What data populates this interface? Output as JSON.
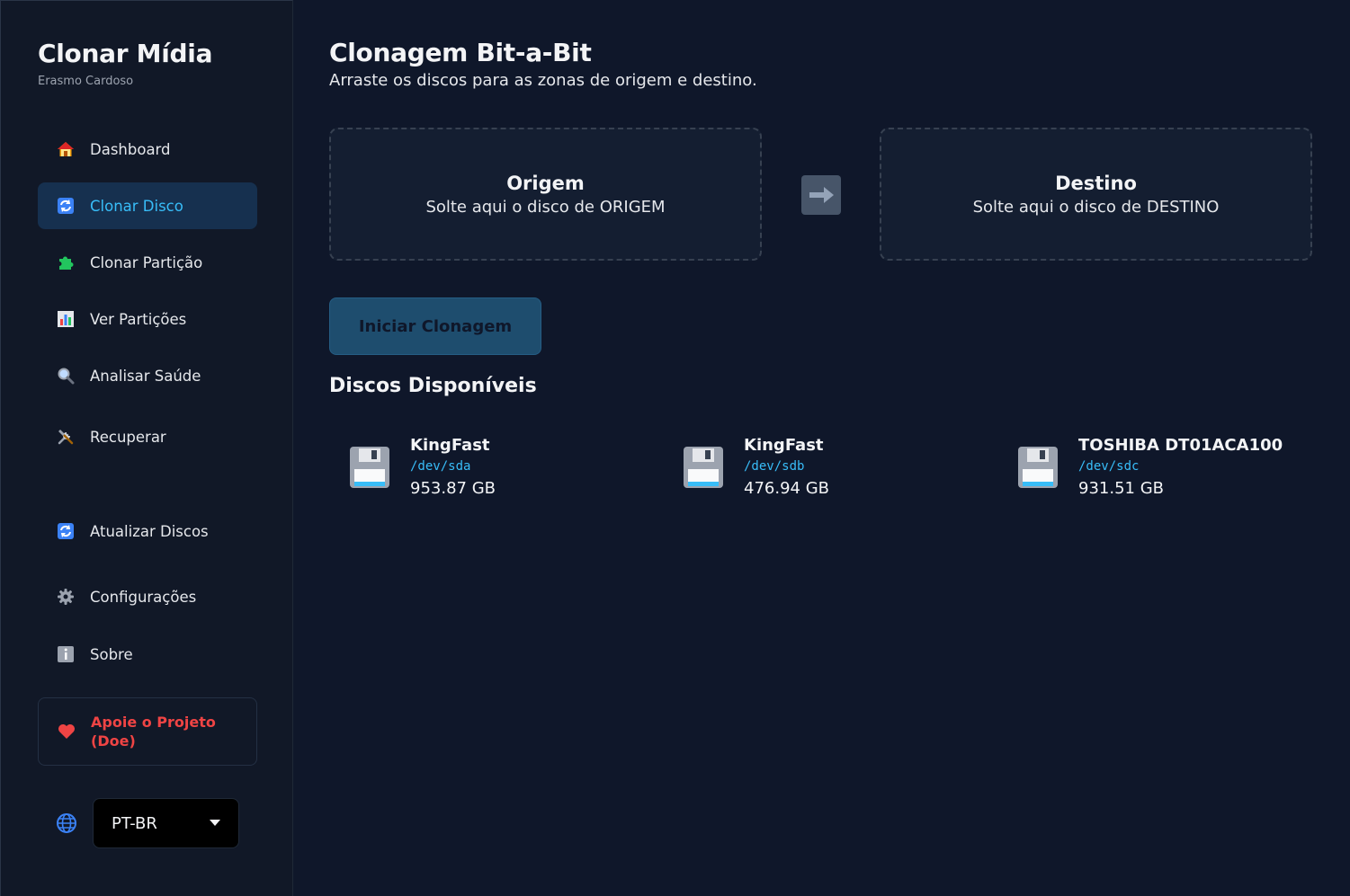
{
  "sidebar": {
    "brand_title": "Clonar Mídia",
    "brand_subtitle": "Erasmo Cardoso",
    "items": [
      {
        "label": "Dashboard",
        "icon": "house-icon"
      },
      {
        "label": "Clonar Disco",
        "icon": "refresh-icon",
        "active": true
      },
      {
        "label": "Clonar Partição",
        "icon": "puzzle-icon"
      },
      {
        "label": "Ver Partições",
        "icon": "bar-chart-icon"
      },
      {
        "label": "Analisar Saúde",
        "icon": "magnifier-icon"
      },
      {
        "label": "Recuperar",
        "icon": "tools-icon"
      }
    ],
    "bottom_items": [
      {
        "label": "Atualizar Discos",
        "icon": "refresh-icon"
      },
      {
        "label": "Configurações",
        "icon": "gear-icon"
      },
      {
        "label": "Sobre",
        "icon": "info-icon"
      }
    ],
    "donate_label": "Apoie o Projeto (Doe)",
    "language": "PT-BR"
  },
  "main": {
    "title": "Clonagem Bit-a-Bit",
    "subtitle": "Arraste os discos para as zonas de origem e destino.",
    "source": {
      "title": "Origem",
      "hint": "Solte aqui o disco de ORIGEM"
    },
    "target": {
      "title": "Destino",
      "hint": "Solte aqui o disco de DESTINO"
    },
    "start_button": "Iniciar Clonagem",
    "disks_title": "Discos Disponíveis",
    "disks": [
      {
        "name": "KingFast",
        "path": "/dev/sda",
        "size": "953.87 GB"
      },
      {
        "name": "KingFast",
        "path": "/dev/sdb",
        "size": "476.94 GB"
      },
      {
        "name": "TOSHIBA DT01ACA100",
        "path": "/dev/sdc",
        "size": "931.51 GB"
      }
    ]
  },
  "colors": {
    "background": "#0f172a",
    "sidebar": "#111827",
    "accent": "#38bdf8",
    "active_bg": "#16304f",
    "danger": "#ef4444"
  }
}
